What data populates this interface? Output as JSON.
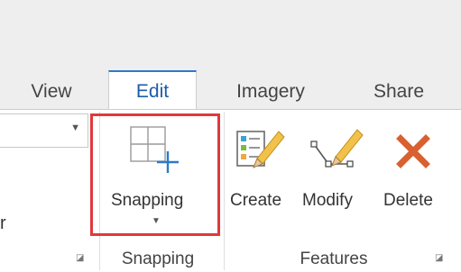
{
  "tabs": [
    {
      "label": "View"
    },
    {
      "label": "Edit",
      "active": true
    },
    {
      "label": "Imagery"
    },
    {
      "label": "Share"
    }
  ],
  "left_group": {
    "partial_label": "r"
  },
  "snapping": {
    "button_label": "Snapping",
    "group_label": "Snapping",
    "highlight_color": "#e0393e"
  },
  "features": {
    "group_label": "Features",
    "buttons": [
      {
        "label": "Create",
        "icon": "create-features-icon"
      },
      {
        "label": "Modify",
        "icon": "modify-features-icon"
      },
      {
        "label": "Delete",
        "icon": "delete-icon"
      }
    ]
  },
  "colors": {
    "accent": "#2d7ac7",
    "delete": "#d8612f",
    "pencil": "#f0c24a"
  }
}
